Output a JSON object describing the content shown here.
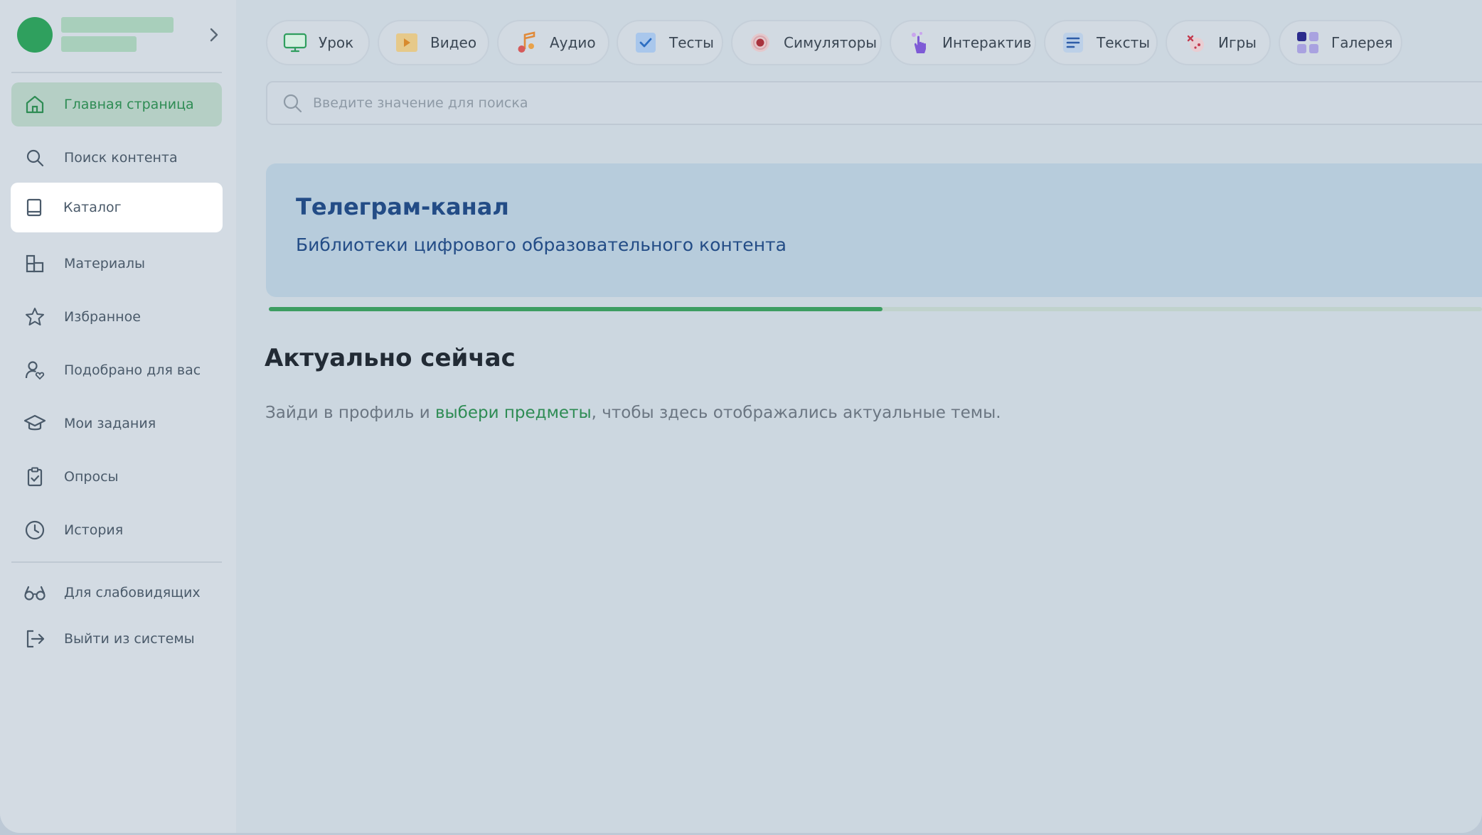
{
  "sidebar": {
    "items": [
      {
        "label": "Главная страница",
        "icon": "home-icon"
      },
      {
        "label": "Поиск контента",
        "icon": "search-icon"
      },
      {
        "label": "Каталог",
        "icon": "book-icon"
      },
      {
        "label": "Материалы",
        "icon": "blocks-icon"
      },
      {
        "label": "Избранное",
        "icon": "star-icon"
      },
      {
        "label": "Подобрано для вас",
        "icon": "user-heart-icon"
      },
      {
        "label": "Мои задания",
        "icon": "graduation-cap-icon"
      },
      {
        "label": "Опросы",
        "icon": "clipboard-check-icon"
      },
      {
        "label": "История",
        "icon": "clock-icon"
      }
    ],
    "footer": [
      {
        "label": "Для слабовидящих",
        "icon": "glasses-icon"
      },
      {
        "label": "Выйти из системы",
        "icon": "logout-icon"
      }
    ]
  },
  "tabs": [
    {
      "label": "Урок",
      "icon": "monitor-icon"
    },
    {
      "label": "Видео",
      "icon": "play-icon"
    },
    {
      "label": "Аудио",
      "icon": "music-note-icon"
    },
    {
      "label": "Тесты",
      "icon": "checkbox-icon"
    },
    {
      "label": "Симуляторы",
      "icon": "simulator-icon"
    },
    {
      "label": "Интерактив",
      "icon": "pointer-hand-icon"
    },
    {
      "label": "Тексты",
      "icon": "text-lines-icon"
    },
    {
      "label": "Игры",
      "icon": "gamepad-icon"
    },
    {
      "label": "Галерея",
      "icon": "gallery-grid-icon"
    }
  ],
  "search": {
    "placeholder": "Введите значение для поиска"
  },
  "banner": {
    "title": "Телеграм-канал",
    "subtitle": "Библиотеки цифрового образовательного контента",
    "progress": 0.506
  },
  "section": {
    "title": "Актуально сейчас",
    "hint_before": "Зайди в профиль и ",
    "hint_link": "выбери предметы",
    "hint_after": ", чтобы здесь отображались актуальные темы."
  },
  "colors": {
    "accent": "#2e8c54",
    "banner_text": "#234c86"
  }
}
